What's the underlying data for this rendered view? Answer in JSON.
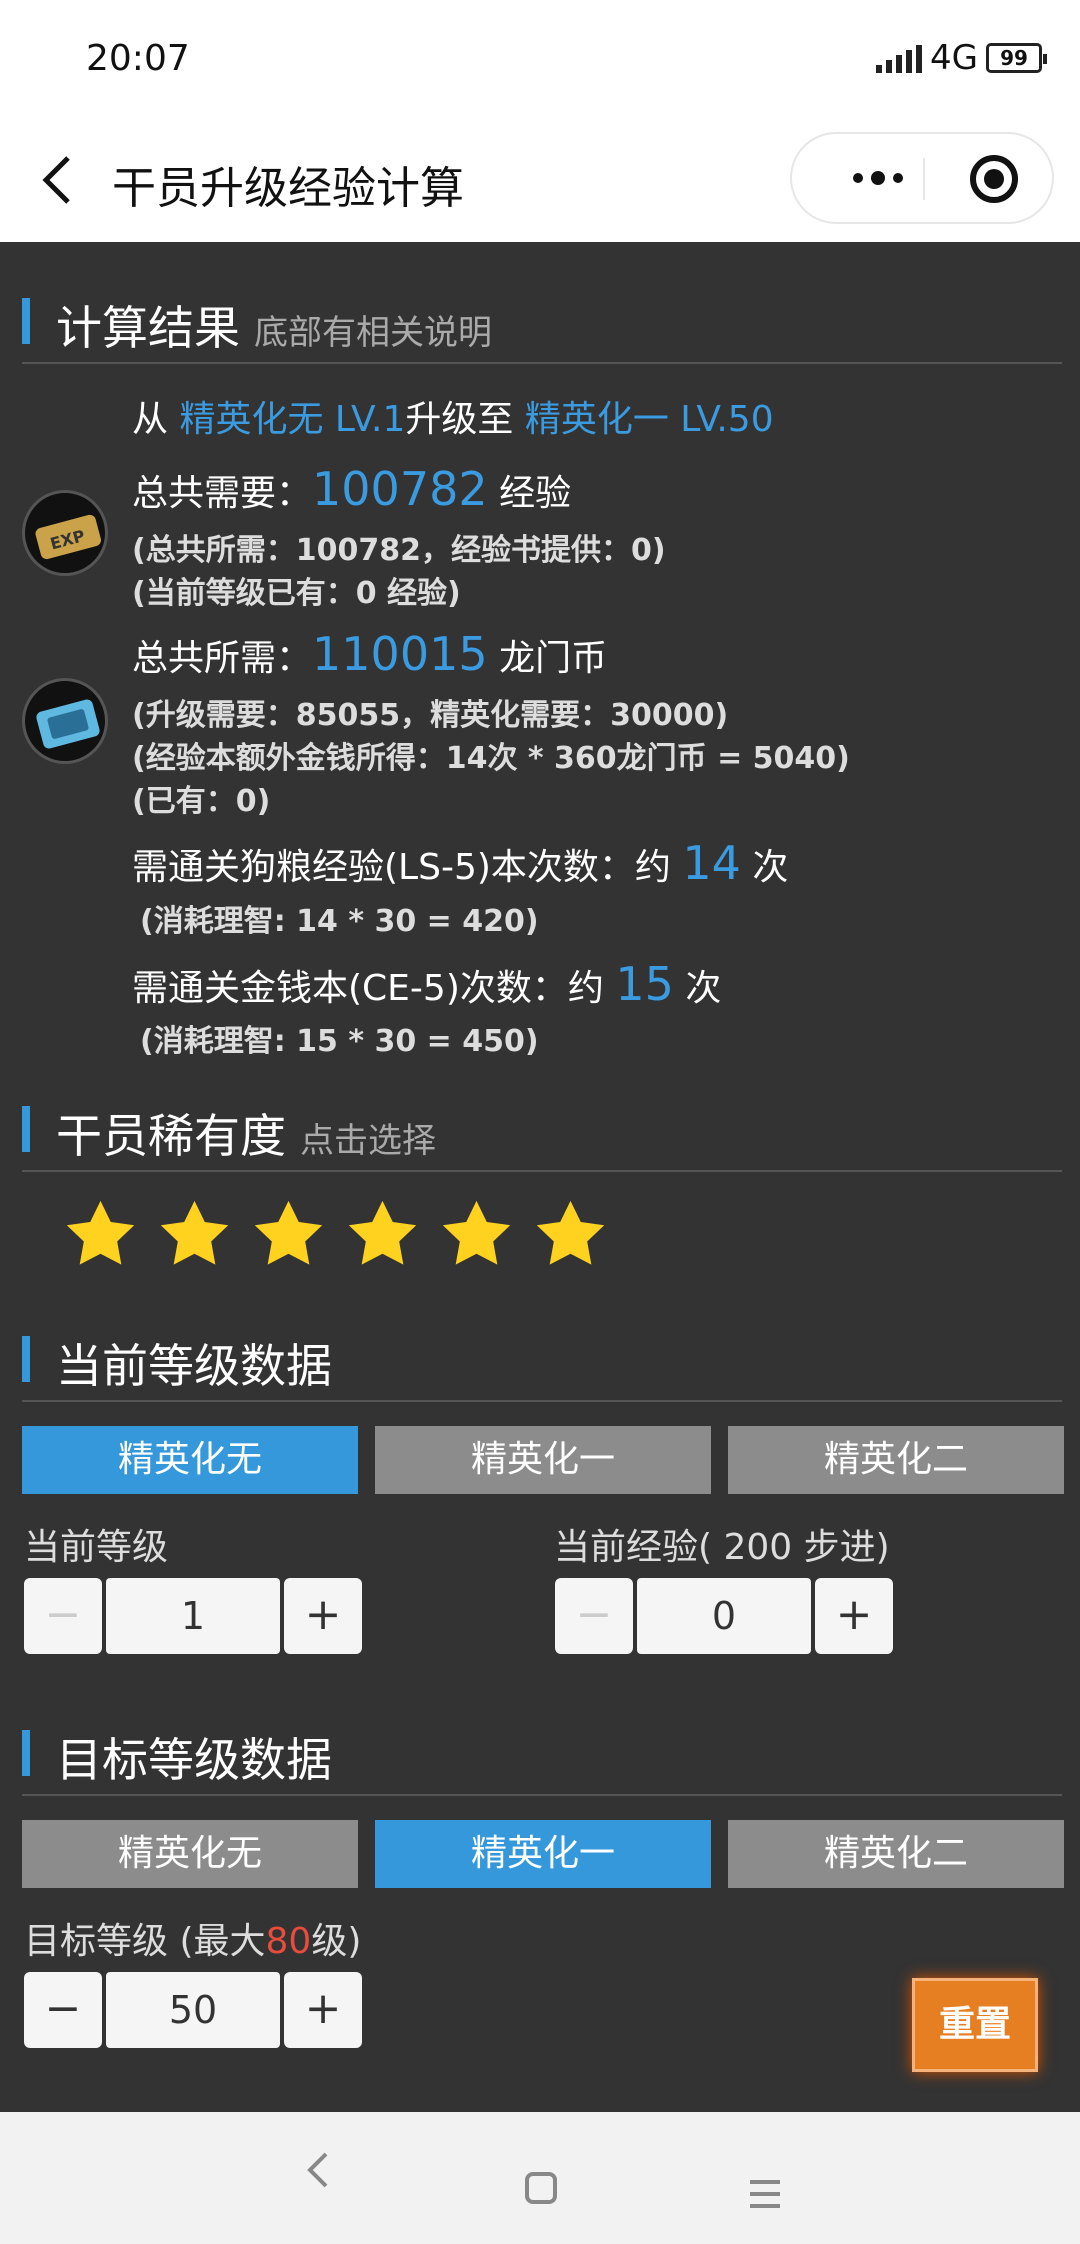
{
  "status": {
    "time": "20:07",
    "network": "4G",
    "battery": "99"
  },
  "header": {
    "title": "干员升级经验计算"
  },
  "result": {
    "heading": "计算结果",
    "heading_sub": "底部有相关说明",
    "from_prefix": "从",
    "from_value": "精英化无 LV.1",
    "upgrade_to": "升级至",
    "to_value": "精英化一 LV.50",
    "exp_prefix": "总共需要：",
    "exp_total": "100782",
    "exp_unit": "经验",
    "exp_detail": "(总共所需：100782，经验书提供：0)",
    "exp_have": "(当前等级已有：0 经验)",
    "money_prefix": "总共所需：",
    "money_total": "110015",
    "money_unit": "龙门币",
    "money_detail": "(升级需要：85055，精英化需要：30000)",
    "money_extra": "(经验本额外金钱所得：14次 * 360龙门币 = 5040)",
    "money_have": "(已有：0)",
    "ls_prefix": "需通关狗粮经验(LS-5)本次数：约",
    "ls_count": "14",
    "ls_unit": "次",
    "ls_cost": "(消耗理智: 14 * 30 = 420)",
    "ce_prefix": "需通关金钱本(CE-5)次数：约",
    "ce_count": "15",
    "ce_unit": "次",
    "ce_cost": "(消耗理智: 15 * 30 = 450)"
  },
  "rarity": {
    "heading": "干员稀有度",
    "heading_sub": "点击选择",
    "stars": 6,
    "star_color": "#ffd21f"
  },
  "current": {
    "heading": "当前等级数据",
    "tabs": [
      "精英化无",
      "精英化一",
      "精英化二"
    ],
    "active_tab": 0,
    "level_label": "当前等级",
    "level_value": "1",
    "exp_label": "当前经验( 200 步进)",
    "exp_value": "0"
  },
  "target": {
    "heading": "目标等级数据",
    "tabs": [
      "精英化无",
      "精英化一",
      "精英化二"
    ],
    "active_tab": 1,
    "level_label_a": "目标等级 (最大",
    "level_max": "80",
    "level_label_b": "级)",
    "level_value": "50"
  },
  "stepper": {
    "minus": "−",
    "plus": "+"
  },
  "reset_label": "重置",
  "colors": {
    "accent": "#3498db",
    "highlight": "#3a9be0",
    "reset": "#e67e22",
    "max": "#e74c3c",
    "background": "#333333"
  }
}
